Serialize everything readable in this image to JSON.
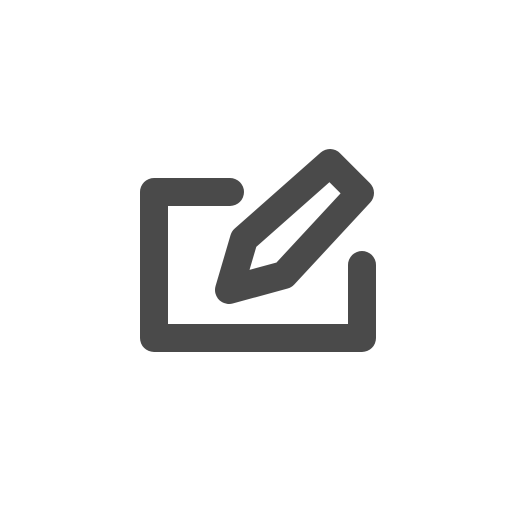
{
  "icon": {
    "name": "edit-icon",
    "color": "#4a4a4a",
    "background": "#ffffff"
  }
}
